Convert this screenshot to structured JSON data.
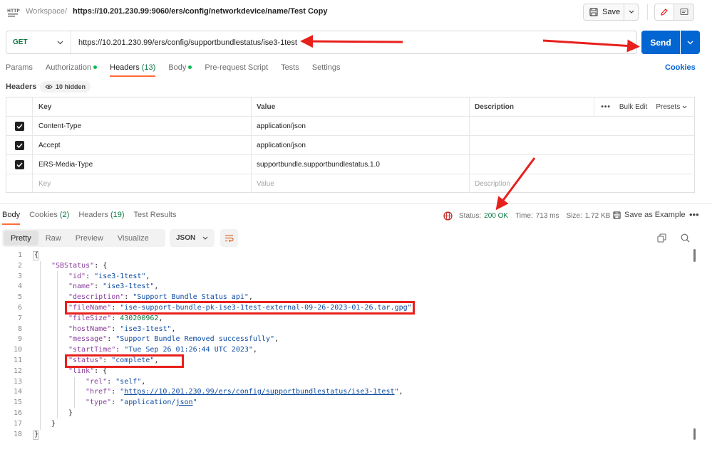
{
  "topbar": {
    "workspace": "Workspace",
    "separator": "/",
    "request_name": "https://10.201.230.99:9060/ers/config/networkdevice/name/Test Copy",
    "save_label": "Save"
  },
  "request": {
    "method": "GET",
    "url": "https://10.201.230.99/ers/config/supportbundlestatus/ise3-1test",
    "send_label": "Send"
  },
  "request_tabs": {
    "params": "Params",
    "authorization": "Authorization",
    "headers": "Headers",
    "headers_count": "(13)",
    "body": "Body",
    "prerequest": "Pre-request Script",
    "tests": "Tests",
    "settings": "Settings",
    "cookies": "Cookies"
  },
  "headers_section": {
    "label": "Headers",
    "hidden": "10 hidden"
  },
  "headers_table": {
    "col_key": "Key",
    "col_value": "Value",
    "col_description": "Description",
    "bulk_edit": "Bulk Edit",
    "presets": "Presets",
    "rows": [
      {
        "key": "Content-Type",
        "value": "application/json"
      },
      {
        "key": "Accept",
        "value": "application/json"
      },
      {
        "key": "ERS-Media-Type",
        "value": "supportbundle.supportbundlestatus.1.0"
      }
    ],
    "placeholder_key": "Key",
    "placeholder_value": "Value",
    "placeholder_description": "Description"
  },
  "response_tabs": {
    "body": "Body",
    "cookies": "Cookies",
    "cookies_count": "(2)",
    "headers": "Headers",
    "headers_count": "(19)",
    "test_results": "Test Results"
  },
  "response_status": {
    "status_label": "Status:",
    "status_value": "200 OK",
    "time_label": "Time:",
    "time_value": "713 ms",
    "size_label": "Size:",
    "size_value": "1.72 KB",
    "save_example": "Save as Example"
  },
  "view_modes": {
    "pretty": "Pretty",
    "raw": "Raw",
    "preview": "Preview",
    "visualize": "Visualize",
    "format": "JSON"
  },
  "code_lines": [
    {
      "n": "1"
    },
    {
      "n": "2"
    },
    {
      "n": "3"
    },
    {
      "n": "4"
    },
    {
      "n": "5"
    },
    {
      "n": "6"
    },
    {
      "n": "7"
    },
    {
      "n": "8"
    },
    {
      "n": "9"
    },
    {
      "n": "10"
    },
    {
      "n": "11"
    },
    {
      "n": "12"
    },
    {
      "n": "13"
    },
    {
      "n": "14"
    },
    {
      "n": "15"
    },
    {
      "n": "16"
    },
    {
      "n": "17"
    },
    {
      "n": "18"
    }
  ],
  "json_body": {
    "root_key": "\"SBStatus\"",
    "id_key": "\"id\"",
    "id_val": "\"ise3-1test\"",
    "name_key": "\"name\"",
    "name_val": "\"ise3-1test\"",
    "description_key": "\"description\"",
    "description_val": "\"Support Bundle Status api\"",
    "filename_key": "\"fileName\"",
    "filename_val": "\"ise-support-bundle-pk-ise3-1test-external-09-26-2023-01-26.tar.gpg\"",
    "filesize_key": "\"fileSize\"",
    "filesize_val": "430200962",
    "hostname_key": "\"hostName\"",
    "hostname_val": "\"ise3-1test\"",
    "message_key": "\"message\"",
    "message_val": "\"Support Bundle Removed successfully\"",
    "starttime_key": "\"startTime\"",
    "starttime_val": "\"Tue Sep 26 01:26:44 UTC 2023\"",
    "status_key": "\"status\"",
    "status_val": "\"complete\"",
    "link_key": "\"link\"",
    "rel_key": "\"rel\"",
    "rel_val": "\"self\"",
    "href_key": "\"href\"",
    "href_val": "https://10.201.230.99/ers/config/supportbundlestatus/ise3-1test",
    "type_key": "\"type\"",
    "type_val_a": "\"application/",
    "type_val_b": "json",
    "type_val_c": "\""
  },
  "colors": {
    "accent_orange": "#ff6c37",
    "send_blue": "#0265d2",
    "ok_green": "#0c7a43",
    "annotation_red": "#e8201c"
  }
}
